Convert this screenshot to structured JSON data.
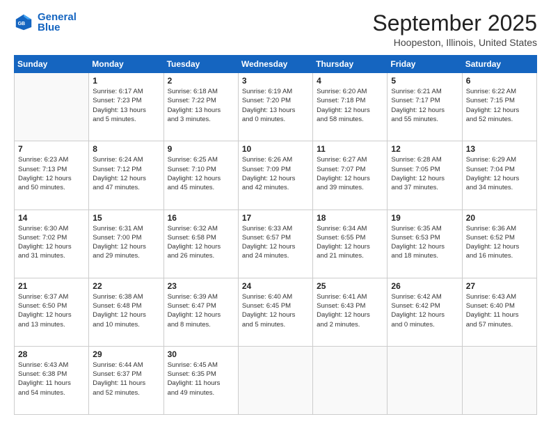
{
  "header": {
    "logo_line1": "General",
    "logo_line2": "Blue",
    "month": "September 2025",
    "location": "Hoopeston, Illinois, United States"
  },
  "weekdays": [
    "Sunday",
    "Monday",
    "Tuesday",
    "Wednesday",
    "Thursday",
    "Friday",
    "Saturday"
  ],
  "weeks": [
    [
      {
        "day": "",
        "info": ""
      },
      {
        "day": "1",
        "info": "Sunrise: 6:17 AM\nSunset: 7:23 PM\nDaylight: 13 hours\nand 5 minutes."
      },
      {
        "day": "2",
        "info": "Sunrise: 6:18 AM\nSunset: 7:22 PM\nDaylight: 13 hours\nand 3 minutes."
      },
      {
        "day": "3",
        "info": "Sunrise: 6:19 AM\nSunset: 7:20 PM\nDaylight: 13 hours\nand 0 minutes."
      },
      {
        "day": "4",
        "info": "Sunrise: 6:20 AM\nSunset: 7:18 PM\nDaylight: 12 hours\nand 58 minutes."
      },
      {
        "day": "5",
        "info": "Sunrise: 6:21 AM\nSunset: 7:17 PM\nDaylight: 12 hours\nand 55 minutes."
      },
      {
        "day": "6",
        "info": "Sunrise: 6:22 AM\nSunset: 7:15 PM\nDaylight: 12 hours\nand 52 minutes."
      }
    ],
    [
      {
        "day": "7",
        "info": "Sunrise: 6:23 AM\nSunset: 7:13 PM\nDaylight: 12 hours\nand 50 minutes."
      },
      {
        "day": "8",
        "info": "Sunrise: 6:24 AM\nSunset: 7:12 PM\nDaylight: 12 hours\nand 47 minutes."
      },
      {
        "day": "9",
        "info": "Sunrise: 6:25 AM\nSunset: 7:10 PM\nDaylight: 12 hours\nand 45 minutes."
      },
      {
        "day": "10",
        "info": "Sunrise: 6:26 AM\nSunset: 7:09 PM\nDaylight: 12 hours\nand 42 minutes."
      },
      {
        "day": "11",
        "info": "Sunrise: 6:27 AM\nSunset: 7:07 PM\nDaylight: 12 hours\nand 39 minutes."
      },
      {
        "day": "12",
        "info": "Sunrise: 6:28 AM\nSunset: 7:05 PM\nDaylight: 12 hours\nand 37 minutes."
      },
      {
        "day": "13",
        "info": "Sunrise: 6:29 AM\nSunset: 7:04 PM\nDaylight: 12 hours\nand 34 minutes."
      }
    ],
    [
      {
        "day": "14",
        "info": "Sunrise: 6:30 AM\nSunset: 7:02 PM\nDaylight: 12 hours\nand 31 minutes."
      },
      {
        "day": "15",
        "info": "Sunrise: 6:31 AM\nSunset: 7:00 PM\nDaylight: 12 hours\nand 29 minutes."
      },
      {
        "day": "16",
        "info": "Sunrise: 6:32 AM\nSunset: 6:58 PM\nDaylight: 12 hours\nand 26 minutes."
      },
      {
        "day": "17",
        "info": "Sunrise: 6:33 AM\nSunset: 6:57 PM\nDaylight: 12 hours\nand 24 minutes."
      },
      {
        "day": "18",
        "info": "Sunrise: 6:34 AM\nSunset: 6:55 PM\nDaylight: 12 hours\nand 21 minutes."
      },
      {
        "day": "19",
        "info": "Sunrise: 6:35 AM\nSunset: 6:53 PM\nDaylight: 12 hours\nand 18 minutes."
      },
      {
        "day": "20",
        "info": "Sunrise: 6:36 AM\nSunset: 6:52 PM\nDaylight: 12 hours\nand 16 minutes."
      }
    ],
    [
      {
        "day": "21",
        "info": "Sunrise: 6:37 AM\nSunset: 6:50 PM\nDaylight: 12 hours\nand 13 minutes."
      },
      {
        "day": "22",
        "info": "Sunrise: 6:38 AM\nSunset: 6:48 PM\nDaylight: 12 hours\nand 10 minutes."
      },
      {
        "day": "23",
        "info": "Sunrise: 6:39 AM\nSunset: 6:47 PM\nDaylight: 12 hours\nand 8 minutes."
      },
      {
        "day": "24",
        "info": "Sunrise: 6:40 AM\nSunset: 6:45 PM\nDaylight: 12 hours\nand 5 minutes."
      },
      {
        "day": "25",
        "info": "Sunrise: 6:41 AM\nSunset: 6:43 PM\nDaylight: 12 hours\nand 2 minutes."
      },
      {
        "day": "26",
        "info": "Sunrise: 6:42 AM\nSunset: 6:42 PM\nDaylight: 12 hours\nand 0 minutes."
      },
      {
        "day": "27",
        "info": "Sunrise: 6:43 AM\nSunset: 6:40 PM\nDaylight: 11 hours\nand 57 minutes."
      }
    ],
    [
      {
        "day": "28",
        "info": "Sunrise: 6:43 AM\nSunset: 6:38 PM\nDaylight: 11 hours\nand 54 minutes."
      },
      {
        "day": "29",
        "info": "Sunrise: 6:44 AM\nSunset: 6:37 PM\nDaylight: 11 hours\nand 52 minutes."
      },
      {
        "day": "30",
        "info": "Sunrise: 6:45 AM\nSunset: 6:35 PM\nDaylight: 11 hours\nand 49 minutes."
      },
      {
        "day": "",
        "info": ""
      },
      {
        "day": "",
        "info": ""
      },
      {
        "day": "",
        "info": ""
      },
      {
        "day": "",
        "info": ""
      }
    ]
  ]
}
